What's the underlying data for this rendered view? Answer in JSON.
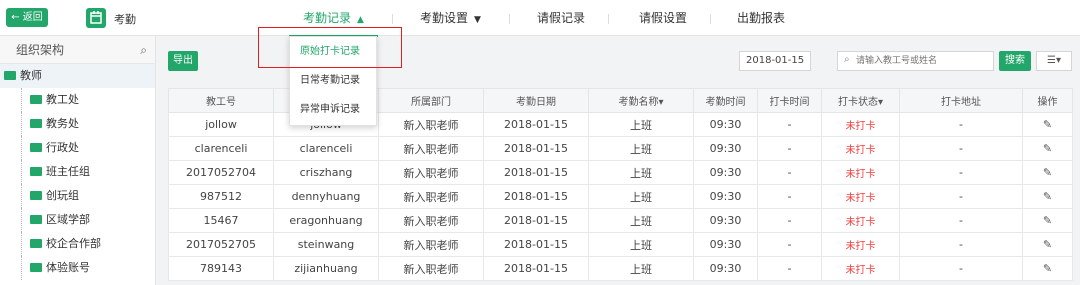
{
  "header": {
    "back_label": "← 返回",
    "app_title": "考勤",
    "nav": [
      {
        "label": "考勤记录",
        "caret": "▲"
      },
      {
        "label": "考勤设置",
        "caret": "▼"
      },
      {
        "label": "请假记录"
      },
      {
        "label": "请假设置"
      },
      {
        "label": "出勤报表"
      }
    ]
  },
  "sidebar": {
    "title": "组织架构",
    "root": "教师",
    "items": [
      "教工处",
      "教务处",
      "行政处",
      "班主任组",
      "创玩组",
      "区域学部",
      "校企合作部",
      "体验账号"
    ]
  },
  "dropdown": {
    "items": [
      "原始打卡记录",
      "日常考勤记录",
      "异常申诉记录"
    ]
  },
  "toolbar": {
    "export_label": "导出",
    "date_value": "2018-01-15",
    "search_placeholder": "请输入教工号或姓名",
    "search_label": "搜索",
    "view_label": "☰▾"
  },
  "table": {
    "columns": [
      "教工号",
      "",
      "所属部门",
      "考勤日期",
      "考勤名称▾",
      "考勤时间",
      "打卡时间",
      "打卡状态▾",
      "打卡地址",
      "操作"
    ],
    "rows": [
      [
        "jollow",
        "jollow",
        "新入职老师",
        "2018-01-15",
        "上班",
        "09:30",
        "-",
        "未打卡",
        "-"
      ],
      [
        "clarenceli",
        "clarenceli",
        "新入职老师",
        "2018-01-15",
        "上班",
        "09:30",
        "-",
        "未打卡",
        "-"
      ],
      [
        "2017052704",
        "criszhang",
        "新入职老师",
        "2018-01-15",
        "上班",
        "09:30",
        "-",
        "未打卡",
        "-"
      ],
      [
        "987512",
        "dennyhuang",
        "新入职老师",
        "2018-01-15",
        "上班",
        "09:30",
        "-",
        "未打卡",
        "-"
      ],
      [
        "15467",
        "eragonhuang",
        "新入职老师",
        "2018-01-15",
        "上班",
        "09:30",
        "-",
        "未打卡",
        "-"
      ],
      [
        "2017052705",
        "steinwang",
        "新入职老师",
        "2018-01-15",
        "上班",
        "09:30",
        "-",
        "未打卡",
        "-"
      ],
      [
        "789143",
        "zijianhuang",
        "新入职老师",
        "2018-01-15",
        "上班",
        "09:30",
        "-",
        "未打卡",
        "-"
      ]
    ]
  },
  "colors": {
    "accent": "#22a66a",
    "alert": "#f23c3c",
    "highlight": "#e02020"
  }
}
